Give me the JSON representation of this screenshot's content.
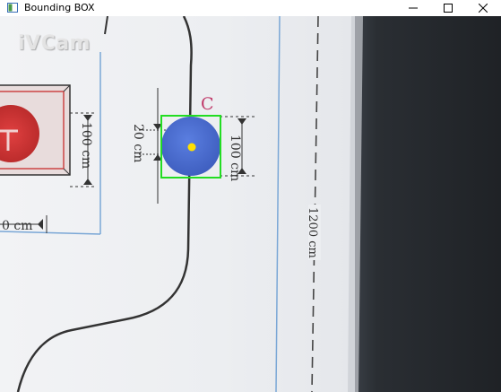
{
  "window": {
    "title": "Bounding BOX",
    "controls": {
      "minimize": "—",
      "maximize": "☐",
      "close": "✕"
    }
  },
  "video_frame": {
    "watermark": "iVCam",
    "labels": {
      "track_letter": "C",
      "dim_20cm": "20 cm",
      "dim_100cm_right": "100 cm",
      "dim_100cm_left": "100 cm",
      "dim_0cm": "0 cm",
      "dim_1200cm": "1200 cm"
    },
    "detection": {
      "box_color": "#22dd22",
      "ball_color": "#4a6fd0",
      "center_color": "#ffe000"
    }
  }
}
